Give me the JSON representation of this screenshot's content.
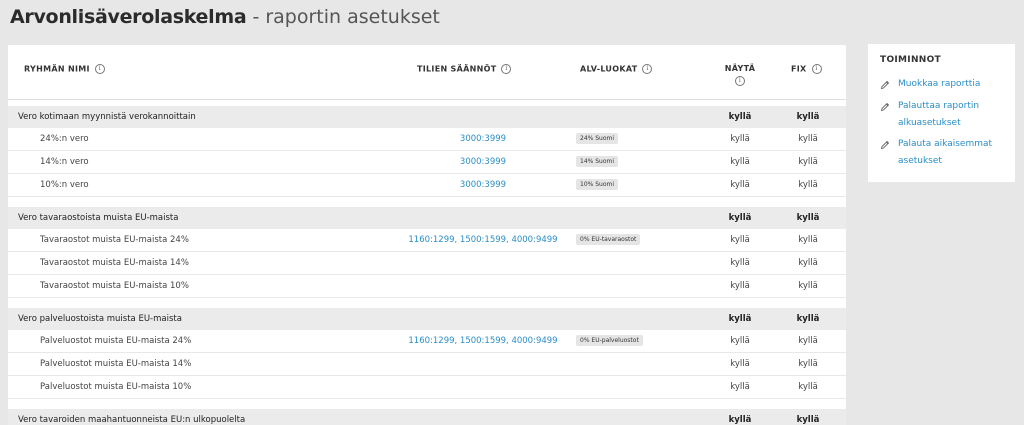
{
  "page": {
    "title_main": "Arvonlisäverolaskelma",
    "title_sub": "- raportin asetukset"
  },
  "table": {
    "headers": {
      "group_name": "RYHMÄN NIMI",
      "account_rules": "TILIEN SÄÄNNÖT",
      "vat_classes": "ALV-LUOKAT",
      "show": "NÄYTÄ",
      "fix": "FIX"
    },
    "info_glyph": "i",
    "groups": [
      {
        "name": "Vero kotimaan myynnistä verokannoittain",
        "show": "kyllä",
        "fix": "kyllä",
        "rows": [
          {
            "name": "24%:n vero",
            "rules": "3000:3999",
            "category": "24% Suomi",
            "show": "kyllä",
            "fix": "kyllä"
          },
          {
            "name": "14%:n vero",
            "rules": "3000:3999",
            "category": "14% Suomi",
            "show": "kyllä",
            "fix": "kyllä"
          },
          {
            "name": "10%:n vero",
            "rules": "3000:3999",
            "category": "10% Suomi",
            "show": "kyllä",
            "fix": "kyllä"
          }
        ]
      },
      {
        "name": "Vero tavaraostoista muista EU-maista",
        "show": "kyllä",
        "fix": "kyllä",
        "rows": [
          {
            "name": "Tavaraostot muista EU-maista 24%",
            "rules": "1160:1299, 1500:1599, 4000:9499",
            "category": "0% EU-tavaraostot",
            "show": "kyllä",
            "fix": "kyllä"
          },
          {
            "name": "Tavaraostot muista EU-maista 14%",
            "rules": "",
            "category": "",
            "show": "kyllä",
            "fix": "kyllä"
          },
          {
            "name": "Tavaraostot muista EU-maista 10%",
            "rules": "",
            "category": "",
            "show": "kyllä",
            "fix": "kyllä"
          }
        ]
      },
      {
        "name": "Vero palveluostoista muista EU-maista",
        "show": "kyllä",
        "fix": "kyllä",
        "rows": [
          {
            "name": "Palveluostot muista EU-maista 24%",
            "rules": "1160:1299, 1500:1599, 4000:9499",
            "category": "0% EU-palveluostot",
            "show": "kyllä",
            "fix": "kyllä"
          },
          {
            "name": "Palveluostot muista EU-maista 14%",
            "rules": "",
            "category": "",
            "show": "kyllä",
            "fix": "kyllä"
          },
          {
            "name": "Palveluostot muista EU-maista 10%",
            "rules": "",
            "category": "",
            "show": "kyllä",
            "fix": "kyllä"
          }
        ]
      },
      {
        "name": "Vero tavaroiden maahantuonneista EU:n ulkopuolelta",
        "show": "kyllä",
        "fix": "kyllä",
        "rows": []
      }
    ]
  },
  "actions": {
    "title": "TOIMINNOT",
    "icon": "pencil-icon",
    "items": [
      {
        "label": "Muokkaa raporttia"
      },
      {
        "label": "Palauttaa raportin alkuasetukset"
      },
      {
        "label": "Palauta aikaisemmat asetukset"
      }
    ]
  },
  "colors": {
    "link": "#2b8ec6",
    "group_row_bg": "#ebebeb",
    "page_bg": "#e7e7e7"
  }
}
